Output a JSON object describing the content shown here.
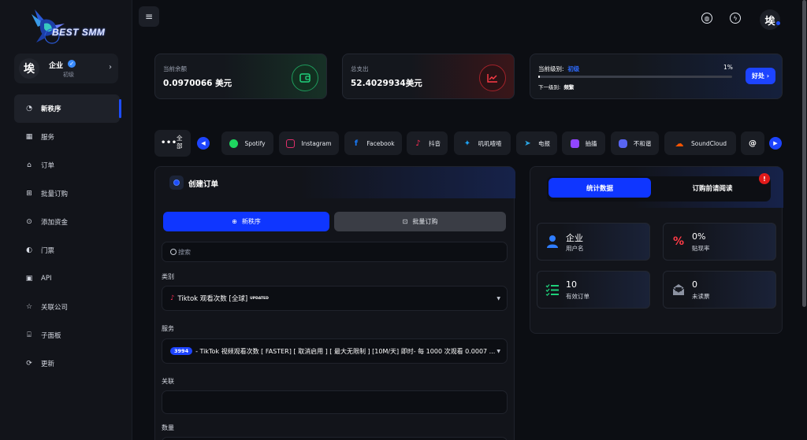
{
  "brand": {
    "logo_text": "BEST SMM"
  },
  "user": {
    "avatar_letter": "埃",
    "name": "企业",
    "level": "初级"
  },
  "sidebar": {
    "items": [
      {
        "label": "新秩序",
        "icon": "new-order-icon",
        "glyph": "◔"
      },
      {
        "label": "服务",
        "icon": "services-icon",
        "glyph": "▦"
      },
      {
        "label": "订单",
        "icon": "orders-icon",
        "glyph": "⌂"
      },
      {
        "label": "批量订购",
        "icon": "bulk-order-icon",
        "glyph": "⊞"
      },
      {
        "label": "添加资金",
        "icon": "add-funds-icon",
        "glyph": "⊙"
      },
      {
        "label": "门票",
        "icon": "tickets-icon",
        "glyph": "◐"
      },
      {
        "label": "API",
        "icon": "api-icon",
        "glyph": "▣"
      },
      {
        "label": "关联公司",
        "icon": "affiliates-icon",
        "glyph": "☆"
      },
      {
        "label": "子面板",
        "icon": "child-panel-icon",
        "glyph": "⌸"
      },
      {
        "label": "更新",
        "icon": "updates-icon",
        "glyph": "⟳"
      }
    ]
  },
  "topbar": {
    "avatar_letter": "埃"
  },
  "stats": {
    "balance_label": "当前余额",
    "balance_value": "0.0970066 美元",
    "spent_label": "总支出",
    "spent_value": "52.4029934美元",
    "level_label": "当前级别:",
    "level_name": "初级",
    "level_pct": "1%",
    "level_progress": 0.01,
    "next_label": "下一级别:",
    "next_name": "频繁",
    "benefits_button": "好处"
  },
  "categories": {
    "all_label": "全部",
    "items": [
      {
        "label": "Spotify",
        "color": "#1ed760",
        "glyph": "●"
      },
      {
        "label": "Instagram",
        "color": "#e1306c",
        "glyph": "◎"
      },
      {
        "label": "Facebook",
        "color": "#1877f2",
        "glyph": "f"
      },
      {
        "label": "抖音",
        "color": "#ff2d55",
        "glyph": "♪"
      },
      {
        "label": "叽叽喳喳",
        "color": "#1da1f2",
        "glyph": "✦"
      },
      {
        "label": "电报",
        "color": "#2aa3e0",
        "glyph": "➤"
      },
      {
        "label": "抽搐",
        "color": "#9146ff",
        "glyph": "▣"
      },
      {
        "label": "不和谐",
        "color": "#5865f2",
        "glyph": "◉"
      },
      {
        "label": "SoundCloud",
        "color": "#ff5500",
        "glyph": "☁"
      },
      {
        "label": "",
        "color": "#ffffff",
        "glyph": "@"
      }
    ]
  },
  "order": {
    "title": "创建订单",
    "tab_new": "新秩序",
    "tab_bulk": "批量订购",
    "search_placeholder": "搜索",
    "category_label": "类别",
    "category_value": "Tiktok 观看次数 [全球]",
    "category_sup": "UPDATED",
    "service_label": "服务",
    "service_badge": "3994",
    "service_value": "- TikTok 视频观看次数 [ FASTER] [ 取消启用 ] [ 最大无限制 ] [10M/天] 即时- 每 1000 次观看 0.0007 ...",
    "link_label": "关联",
    "quantity_label": "数量"
  },
  "right": {
    "tab_stats": "统计数据",
    "tab_read": "订购前请阅读",
    "alert": "!",
    "cards": [
      {
        "value": "企业",
        "label": "用户名",
        "icon": "user-icon"
      },
      {
        "value": "0%",
        "label": "贴现率",
        "icon": "percent-icon"
      },
      {
        "value": "10",
        "label": "有效订单",
        "icon": "list-icon"
      },
      {
        "value": "0",
        "label": "未读票",
        "icon": "ticket-icon"
      }
    ]
  }
}
